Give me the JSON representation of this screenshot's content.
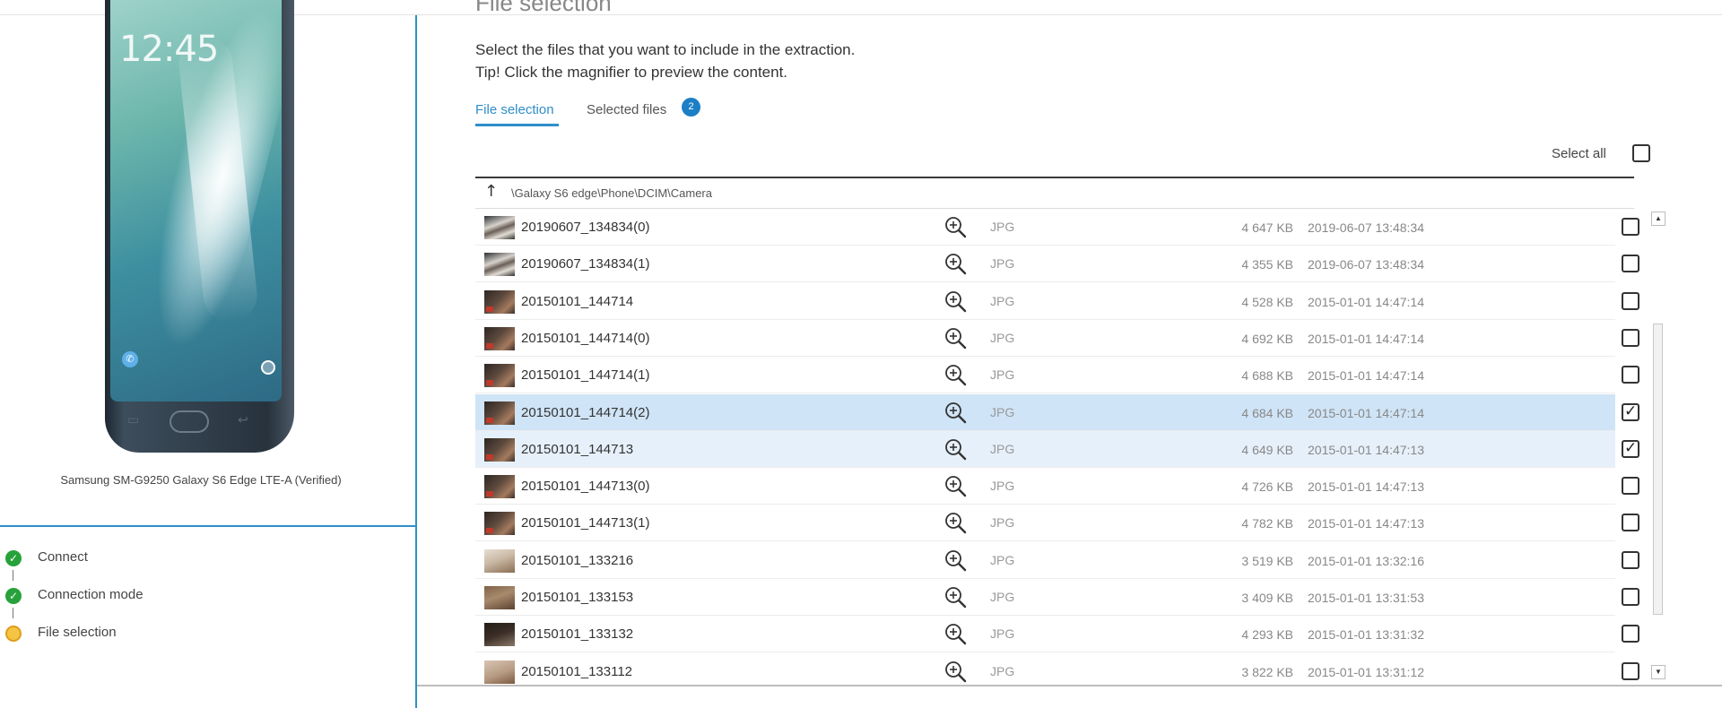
{
  "device": {
    "clock": "12:45",
    "name": "Samsung SM-G9250 Galaxy S6 Edge LTE-A (Verified)"
  },
  "steps": [
    {
      "label": "Connect",
      "state": "done"
    },
    {
      "label": "Connection mode",
      "state": "done"
    },
    {
      "label": "File selection",
      "state": "current"
    }
  ],
  "main": {
    "header": "File selection",
    "intro_line1": "Select the files that you want to include in the extraction.",
    "intro_line2": "Tip! Click the magnifier to preview the content.",
    "tabs": [
      {
        "label": "File selection",
        "active": true
      },
      {
        "label": "Selected files",
        "active": false
      }
    ],
    "selected_count": "2",
    "select_all_label": "Select all",
    "path": "\\Galaxy S6 edge\\Phone\\DCIM\\Camera"
  },
  "files": [
    {
      "name": "20190607_134834(0)",
      "type": "JPG",
      "size": "4 647 KB",
      "date": "2019-06-07 13:48:34",
      "checked": false
    },
    {
      "name": "20190607_134834(1)",
      "type": "JPG",
      "size": "4 355 KB",
      "date": "2019-06-07 13:48:34",
      "checked": false
    },
    {
      "name": "20150101_144714",
      "type": "JPG",
      "size": "4 528 KB",
      "date": "2015-01-01 14:47:14",
      "checked": false
    },
    {
      "name": "20150101_144714(0)",
      "type": "JPG",
      "size": "4 692 KB",
      "date": "2015-01-01 14:47:14",
      "checked": false
    },
    {
      "name": "20150101_144714(1)",
      "type": "JPG",
      "size": "4 688 KB",
      "date": "2015-01-01 14:47:14",
      "checked": false
    },
    {
      "name": "20150101_144714(2)",
      "type": "JPG",
      "size": "4 684 KB",
      "date": "2015-01-01 14:47:14",
      "checked": true
    },
    {
      "name": "20150101_144713",
      "type": "JPG",
      "size": "4 649 KB",
      "date": "2015-01-01 14:47:13",
      "checked": true
    },
    {
      "name": "20150101_144713(0)",
      "type": "JPG",
      "size": "4 726 KB",
      "date": "2015-01-01 14:47:13",
      "checked": false
    },
    {
      "name": "20150101_144713(1)",
      "type": "JPG",
      "size": "4 782 KB",
      "date": "2015-01-01 14:47:13",
      "checked": false
    },
    {
      "name": "20150101_133216",
      "type": "JPG",
      "size": "3 519 KB",
      "date": "2015-01-01 13:32:16",
      "checked": false
    },
    {
      "name": "20150101_133153",
      "type": "JPG",
      "size": "3 409 KB",
      "date": "2015-01-01 13:31:53",
      "checked": false
    },
    {
      "name": "20150101_133132",
      "type": "JPG",
      "size": "4 293 KB",
      "date": "2015-01-01 13:31:32",
      "checked": false
    },
    {
      "name": "20150101_133112",
      "type": "JPG",
      "size": "3 822 KB",
      "date": "2015-01-01 13:31:12",
      "checked": false
    }
  ],
  "icons": {
    "magnifier": "zoom-in-icon",
    "up": "arrow-up-icon",
    "done": "check-circle-icon",
    "current": "pending-circle-icon"
  },
  "colors": {
    "accent": "#2f8ec9",
    "badge": "#1c7fc6",
    "done": "#27a23b",
    "current": "#f4c542",
    "row_selected": "#cfe4f6"
  }
}
